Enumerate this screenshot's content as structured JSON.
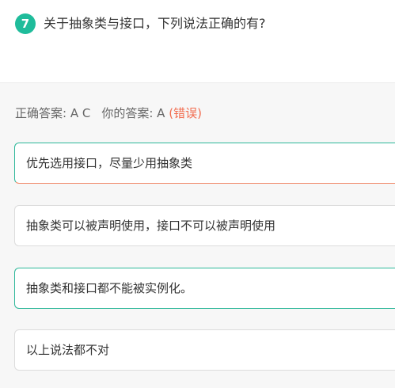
{
  "question": {
    "number": "7",
    "text": "关于抽象类与接口，下列说法正确的有?"
  },
  "result": {
    "correct_label": "正确答案: ",
    "correct_value": "A C",
    "yours_label": "你的答案: ",
    "yours_value": "A",
    "status": "(错误)"
  },
  "options": [
    {
      "text": "优先选用接口，尽量少用抽象类"
    },
    {
      "text": "抽象类可以被声明使用，接口不可以被声明使用"
    },
    {
      "text": "抽象类和接口都不能被实例化。"
    },
    {
      "text": "以上说法都不对"
    }
  ],
  "colors": {
    "accent": "#1fbc9b",
    "error": "#f26c4f"
  }
}
